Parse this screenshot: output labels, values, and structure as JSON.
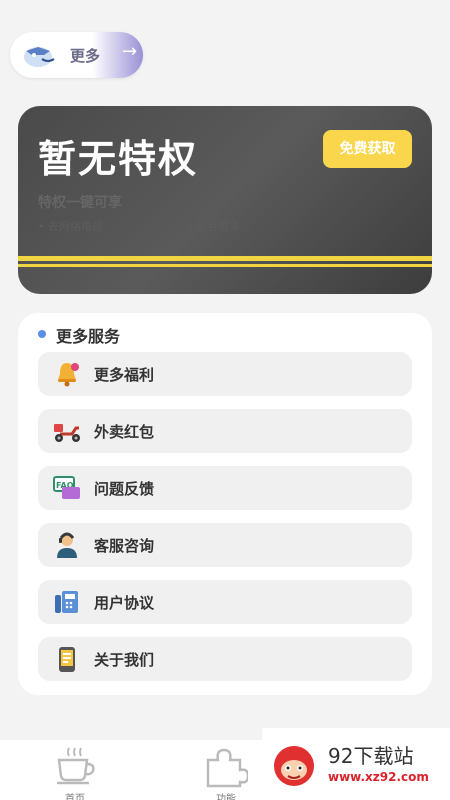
{
  "more_pill": {
    "label": "更多"
  },
  "vip": {
    "title": "暂无特权",
    "claim_button": "免费获取",
    "subtitle": "特权一键可享",
    "features": [
      "去网络电视",
      "看看更多"
    ]
  },
  "services": {
    "heading": "更多服务",
    "items": [
      {
        "label": "更多福利",
        "icon": "bell-icon"
      },
      {
        "label": "外卖红包",
        "icon": "scooter-icon"
      },
      {
        "label": "问题反馈",
        "icon": "faq-icon"
      },
      {
        "label": "客服咨询",
        "icon": "support-agent-icon"
      },
      {
        "label": "用户协议",
        "icon": "fax-icon"
      },
      {
        "label": "关于我们",
        "icon": "phone-info-icon"
      }
    ]
  },
  "tabbar": {
    "tabs": [
      {
        "label": "首页",
        "icon": "coffee-cup-icon"
      },
      {
        "label": "功能",
        "icon": "puzzle-icon"
      }
    ]
  },
  "watermark": {
    "title": "92下载站",
    "url": "www.xz92.com"
  }
}
